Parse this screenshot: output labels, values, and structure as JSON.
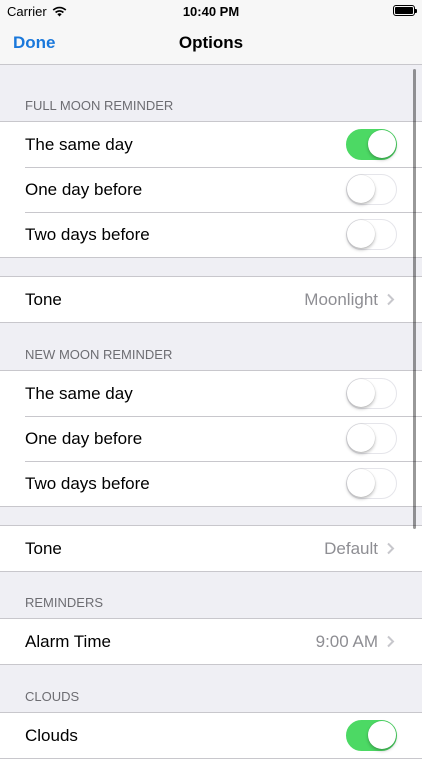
{
  "status_bar": {
    "carrier": "Carrier",
    "time": "10:40 PM",
    "battery_level": 1.0
  },
  "nav": {
    "done_label": "Done",
    "title": "Options"
  },
  "colors": {
    "accent": "#1a78db",
    "toggle_on": "#4cd964",
    "secondary_text": "#8e8e93"
  },
  "full_moon": {
    "header": "FULL MOON REMINDER",
    "rows": [
      {
        "label": "The same day",
        "on": true
      },
      {
        "label": "One day before",
        "on": false
      },
      {
        "label": "Two days before",
        "on": false
      }
    ],
    "tone_label": "Tone",
    "tone_value": "Moonlight"
  },
  "new_moon": {
    "header": "NEW MOON REMINDER",
    "rows": [
      {
        "label": "The same day",
        "on": false
      },
      {
        "label": "One day before",
        "on": false
      },
      {
        "label": "Two days before",
        "on": false
      }
    ],
    "tone_label": "Tone",
    "tone_value": "Default"
  },
  "reminders": {
    "header": "REMINDERS",
    "alarm_label": "Alarm Time",
    "alarm_value": "9:00 AM"
  },
  "clouds": {
    "header": "CLOUDS",
    "label": "Clouds",
    "on": true
  },
  "icons": {
    "wifi": "wifi-icon",
    "battery": "battery-icon",
    "chevron": "chevron-right-icon",
    "scroll_indicator": "scroll-indicator"
  }
}
